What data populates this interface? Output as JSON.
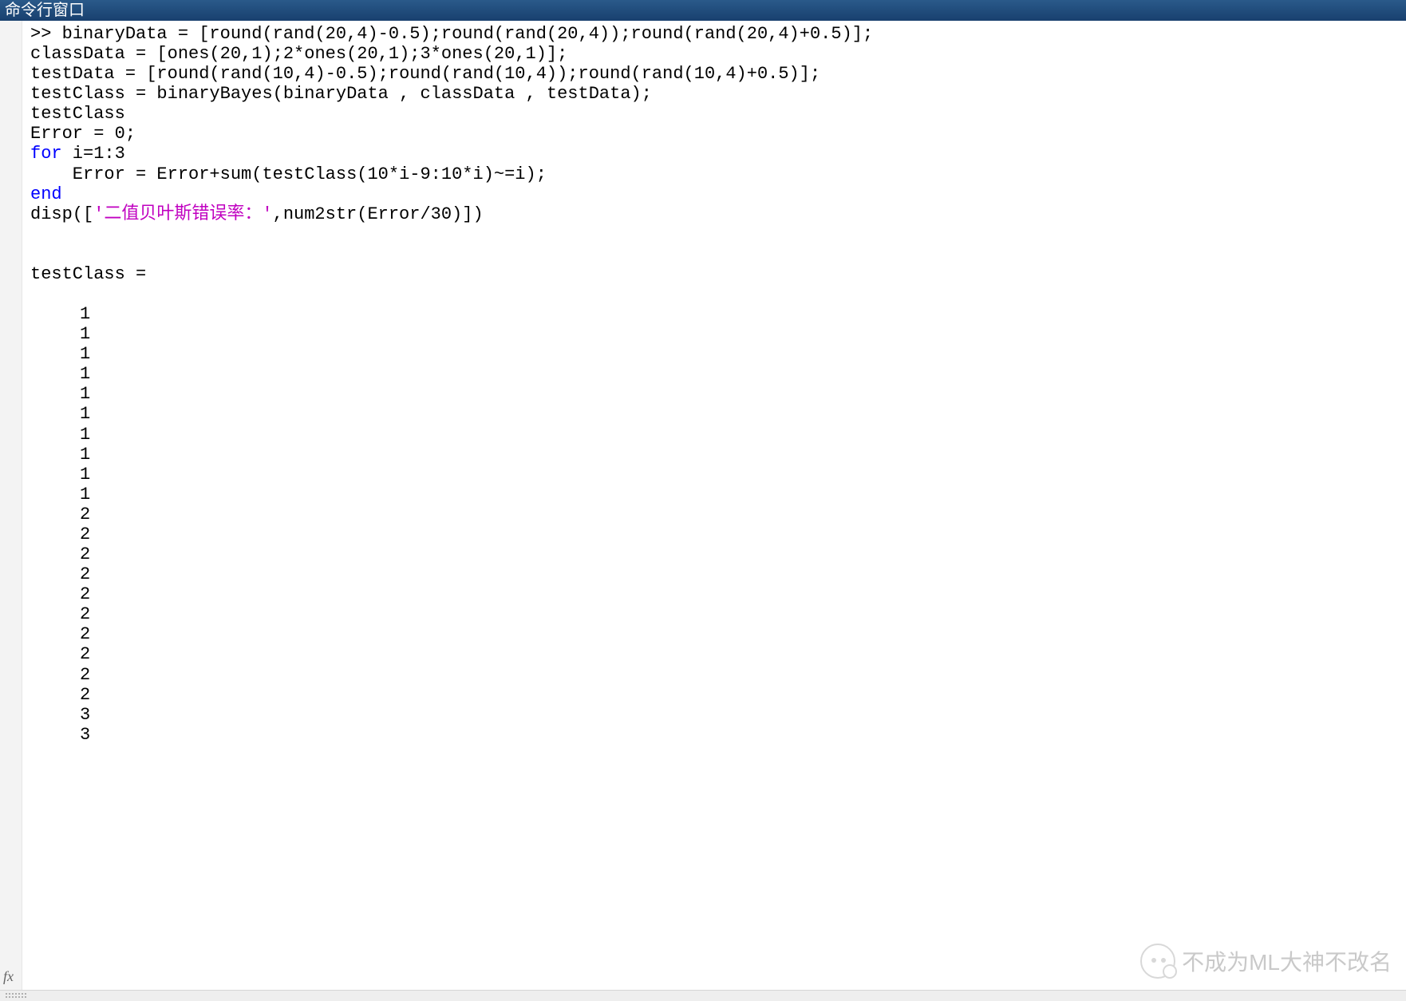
{
  "window": {
    "title": "命令行窗口"
  },
  "code": {
    "line1_pre": ">> binaryData = [round(rand(20,4)-0.5);round(rand(20,4));round(rand(20,4)+0.5)];",
    "line2": "classData = [ones(20,1);2*ones(20,1);3*ones(20,1)];",
    "line3": "testData = [round(rand(10,4)-0.5);round(rand(10,4));round(rand(10,4)+0.5)];",
    "line4": "testClass = binaryBayes(binaryData , classData , testData);",
    "line5": "testClass",
    "line6": "Error = 0;",
    "line7_kw": "for",
    "line7_rest": " i=1:3",
    "line8": "    Error = Error+sum(testClass(10*i-9:10*i)~=i);",
    "line9_kw": "end",
    "line10_a": "disp([",
    "line10_str": "'二值贝叶斯错误率：'",
    "line10_b": ",num2str(Error/30)])"
  },
  "output": {
    "header": "testClass =",
    "values": [
      1,
      1,
      1,
      1,
      1,
      1,
      1,
      1,
      1,
      1,
      2,
      2,
      2,
      2,
      2,
      2,
      2,
      2,
      2,
      2,
      3,
      3
    ]
  },
  "fx_label": "fx",
  "watermark": {
    "text": "不成为ML大神不改名"
  }
}
